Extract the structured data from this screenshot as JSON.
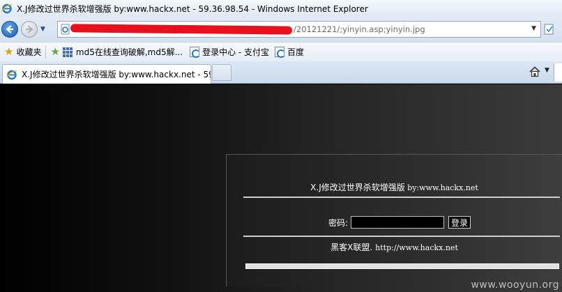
{
  "window": {
    "title": "X.J修改过世界杀软增强版 by:www.hackx.net - 59.36.98.54 - Windows Internet Explorer"
  },
  "address_bar": {
    "url_visible_suffix": "/20121221/;yinyin.asp;yinyin.jpg",
    "redaction_color": "#e8101c"
  },
  "favorites_bar": {
    "favorites_label": "收藏夹",
    "links": [
      {
        "label": "md5在线查询破解,md5解...",
        "icon": "grid-icon"
      },
      {
        "label": "登录中心 - 支付宝",
        "icon": "ie-page-icon"
      },
      {
        "label": "百度",
        "icon": "ie-page-icon"
      }
    ]
  },
  "tab": {
    "title": "X.J修改过世界杀软增强版 by:www.hackx.net - 59...."
  },
  "page": {
    "heading_cn": "X.J修改过世界杀软增强版",
    "heading_by": " by:www.hackx.net",
    "password_label": "密码:",
    "password_value": "",
    "login_button": "登录",
    "footer_cn": "黑客X联盟.",
    "footer_url": "http://www.hackx.net"
  },
  "watermark": "www.wooyun.org",
  "colors": {
    "page_background": "#000000",
    "panel_text": "#ffffff",
    "ie_blue": "#1e78c8"
  }
}
